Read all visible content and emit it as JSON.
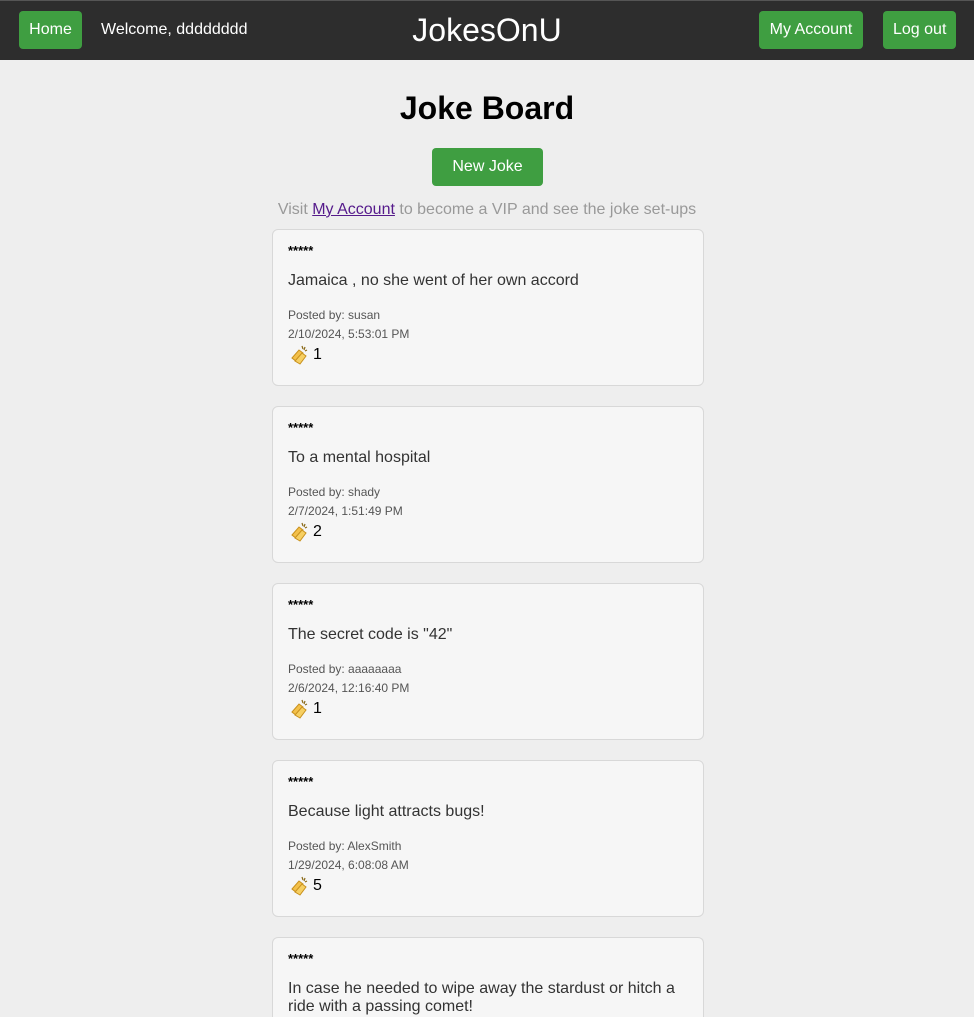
{
  "nav": {
    "home_label": "Home",
    "welcome_text": "Welcome, dddddddd",
    "brand": "JokesOnU",
    "account_label": "My Account",
    "logout_label": "Log out"
  },
  "main": {
    "title": "Joke Board",
    "new_joke_label": "New Joke",
    "vip_prefix": "Visit ",
    "vip_link": "My Account",
    "vip_suffix": " to become a VIP and see the joke set-ups"
  },
  "accent_color": "#3f9e41",
  "jokes": [
    {
      "setup": "*****",
      "punchline": "Jamaica , no she went of her own accord",
      "posted_by": "Posted by: susan",
      "timestamp": "2/10/2024, 5:53:01 PM",
      "claps": "1",
      "icon": "clapping-hands-icon"
    },
    {
      "setup": "*****",
      "punchline": "To a mental hospital",
      "posted_by": "Posted by: shady",
      "timestamp": "2/7/2024, 1:51:49 PM",
      "claps": "2",
      "icon": "clapping-hands-icon"
    },
    {
      "setup": "*****",
      "punchline": "The secret code is \"42\"",
      "posted_by": "Posted by: aaaaaaaa",
      "timestamp": "2/6/2024, 12:16:40 PM",
      "claps": "1",
      "icon": "clapping-hands-icon"
    },
    {
      "setup": "*****",
      "punchline": "Because light attracts bugs!",
      "posted_by": "Posted by: AlexSmith",
      "timestamp": "1/29/2024, 6:08:08 AM",
      "claps": "5",
      "icon": "clapping-hands-icon"
    },
    {
      "setup": "*****",
      "punchline": "In case he needed to wipe away the stardust or hitch a ride with a passing comet!",
      "posted_by": "",
      "timestamp": "",
      "claps": "",
      "icon": "clapping-hands-icon"
    }
  ]
}
